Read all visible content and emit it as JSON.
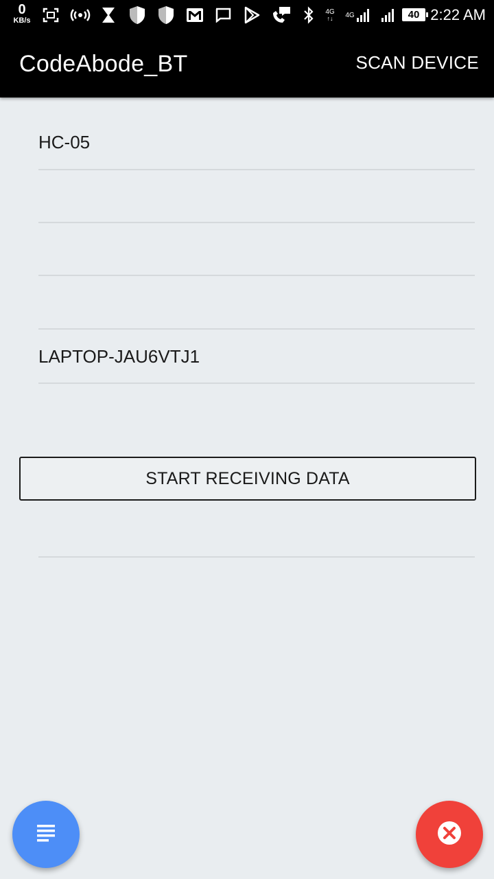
{
  "status_bar": {
    "speed_value": "0",
    "speed_unit": "KB/s",
    "network_4g_1": "4G",
    "network_4g_2": "4G",
    "battery": "40",
    "time": "2:22 AM",
    "icons": [
      "screenshot-icon",
      "hotspot-icon",
      "hourglass-icon",
      "shield-icon",
      "shield-icon",
      "gmail-icon",
      "message-icon",
      "play-store-icon",
      "chat-call-icon",
      "bluetooth-icon",
      "signal-icon",
      "signal-icon"
    ]
  },
  "app_bar": {
    "title": "CodeAbode_BT",
    "action": "SCAN DEVICE"
  },
  "devices": [
    {
      "label": "HC-05"
    },
    {
      "label": ""
    },
    {
      "label": ""
    },
    {
      "label": "LAPTOP-JAU6VTJ1"
    }
  ],
  "start_button": "START RECEIVING DATA",
  "fab_left_icon": "list-icon",
  "fab_right_icon": "close-icon",
  "colors": {
    "background": "#e9edf0",
    "appbar": "#000000",
    "fab_left": "#4d8ef7",
    "fab_right": "#f0413a"
  }
}
